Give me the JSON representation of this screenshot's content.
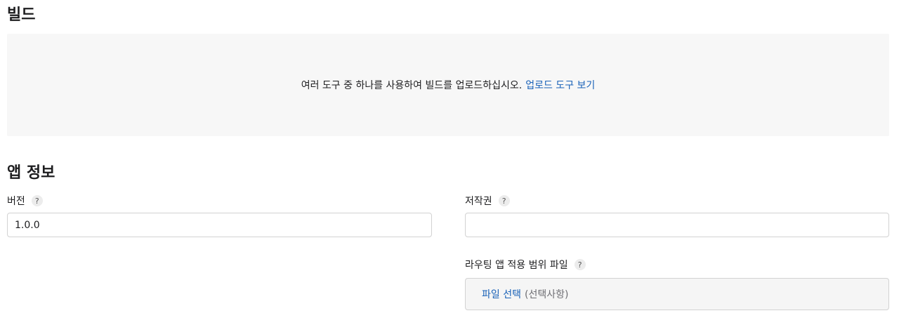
{
  "build": {
    "title": "빌드",
    "upload_message": "여러 도구 중 하나를 사용하여 빌드를 업로드하십시오.",
    "upload_tools_link": "업로드 도구 보기"
  },
  "app_info": {
    "title": "앱 정보",
    "version": {
      "label": "버전",
      "help": "?",
      "value": "1.0.0"
    },
    "copyright": {
      "label": "저작권",
      "help": "?",
      "value": ""
    },
    "routing_coverage": {
      "label": "라우팅 앱 적용 범위 파일",
      "help": "?",
      "choose_file": "파일 선택",
      "optional": "(선택사항)"
    }
  },
  "colors": {
    "link": "#1a62b8",
    "upload_bg": "#f7f7f7",
    "file_box_bg": "#f5f5f5",
    "border": "#d2d2d2"
  }
}
